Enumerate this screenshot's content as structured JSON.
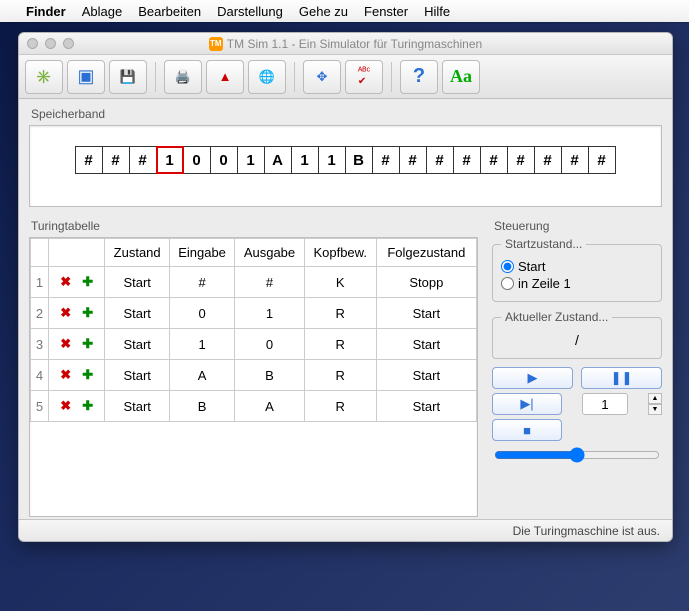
{
  "menubar": {
    "appname": "Finder",
    "items": [
      "Ablage",
      "Bearbeiten",
      "Darstellung",
      "Gehe zu",
      "Fenster",
      "Hilfe"
    ]
  },
  "window": {
    "title": "TM Sim 1.1 - Ein Simulator für Turingmaschinen"
  },
  "sections": {
    "tape_label": "Speicherband",
    "table_label": "Turingtabelle",
    "control_label": "Steuerung"
  },
  "tape": {
    "cells": [
      "#",
      "#",
      "#",
      "1",
      "0",
      "0",
      "1",
      "A",
      "1",
      "1",
      "B",
      "#",
      "#",
      "#",
      "#",
      "#",
      "#",
      "#",
      "#",
      "#"
    ],
    "head_index": 3
  },
  "table": {
    "headers": [
      "",
      "",
      "Zustand",
      "Eingabe",
      "Ausgabe",
      "Kopfbew.",
      "Folgezustand"
    ],
    "rows": [
      {
        "n": "1",
        "state": "Start",
        "in": "#",
        "out": "#",
        "move": "K",
        "next": "Stopp"
      },
      {
        "n": "2",
        "state": "Start",
        "in": "0",
        "out": "1",
        "move": "R",
        "next": "Start"
      },
      {
        "n": "3",
        "state": "Start",
        "in": "1",
        "out": "0",
        "move": "R",
        "next": "Start"
      },
      {
        "n": "4",
        "state": "Start",
        "in": "A",
        "out": "B",
        "move": "R",
        "next": "Start"
      },
      {
        "n": "5",
        "state": "Start",
        "in": "B",
        "out": "A",
        "move": "R",
        "next": "Start"
      }
    ]
  },
  "control": {
    "start_group_label": "Startzustand...",
    "radio_start": "Start",
    "radio_line1": "in Zeile 1",
    "radio_selected": "start",
    "current_group_label": "Aktueller Zustand...",
    "current_state": "/",
    "step_value": "1",
    "slider_value": 50
  },
  "status": "Die Turingmaschine ist aus."
}
